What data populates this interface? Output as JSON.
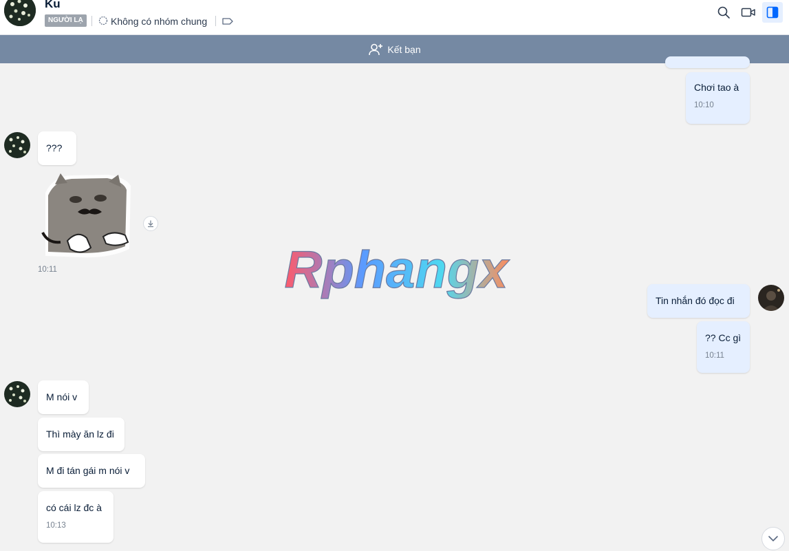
{
  "header": {
    "contact_name": "Ku",
    "stranger_badge": "NGƯỜI LẠ",
    "common_groups": "Không có nhóm chung",
    "icons": [
      "search-icon",
      "video-call-icon",
      "sidebar-toggle-icon"
    ],
    "accent_color": "#0068ff"
  },
  "friend_bar": {
    "label": "Kết bạn",
    "icon": "add-friend-icon",
    "bg_color": "#7589a3"
  },
  "watermark": {
    "text": "Rphangx"
  },
  "messages": [
    {
      "from": "me",
      "text": "Chơi tao à",
      "time": "10:10"
    },
    {
      "from": "them",
      "text": "???"
    },
    {
      "from": "them",
      "type": "sticker",
      "sticker": "cat-with-mustache",
      "time": "10:11"
    },
    {
      "from": "me",
      "text": "Tin nhắn đó đọc đi"
    },
    {
      "from": "me",
      "text": "?? Cc gì",
      "time": "10:11"
    },
    {
      "from": "them",
      "text": "M nói v"
    },
    {
      "from": "them",
      "text": "Thì mày ăn lz đi"
    },
    {
      "from": "them",
      "text": "M đi tán gái m nói v"
    },
    {
      "from": "them",
      "text": "có cái lz đc à",
      "time": "10:13"
    }
  ]
}
